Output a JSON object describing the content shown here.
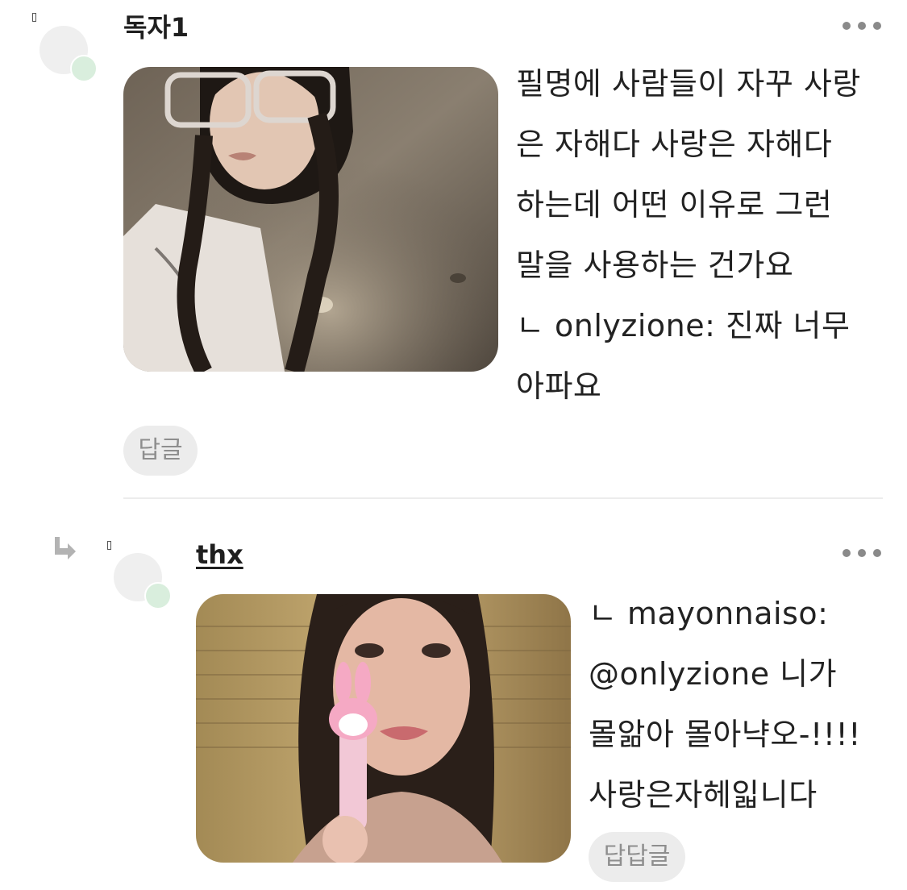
{
  "comments": [
    {
      "author": "독자1",
      "text": "필명에 사람들이 자꾸 사랑\n은 자해다 사랑은 자해다\n하는데 어떤 이유로 그런\n말을 사용하는 건가요\nㄴ onlyzione: 진짜 너무\n아파요",
      "reply_label": "답글",
      "photo_alt": "selfie-with-glasses-and-braids"
    },
    {
      "author": "thx",
      "text": "ㄴ mayonnaiso:\n@onlyzione 니가\n몰앎아 몰아냑오-!!!!\n사랑은자헤읿니다",
      "reply_label": "답답글",
      "photo_alt": "selfie-with-pink-toy-microphone"
    }
  ],
  "icons": {
    "more": "more-horizontal-icon",
    "reply_arrow": "reply-arrow-icon",
    "status_dot": "online-status-dot"
  },
  "colors": {
    "status_dot": "#d9eedd",
    "avatar_bg": "#efefef",
    "reply_button_bg": "#ececec",
    "reply_button_text": "#8e8e8e",
    "more_dots": "#8a8a8a"
  }
}
